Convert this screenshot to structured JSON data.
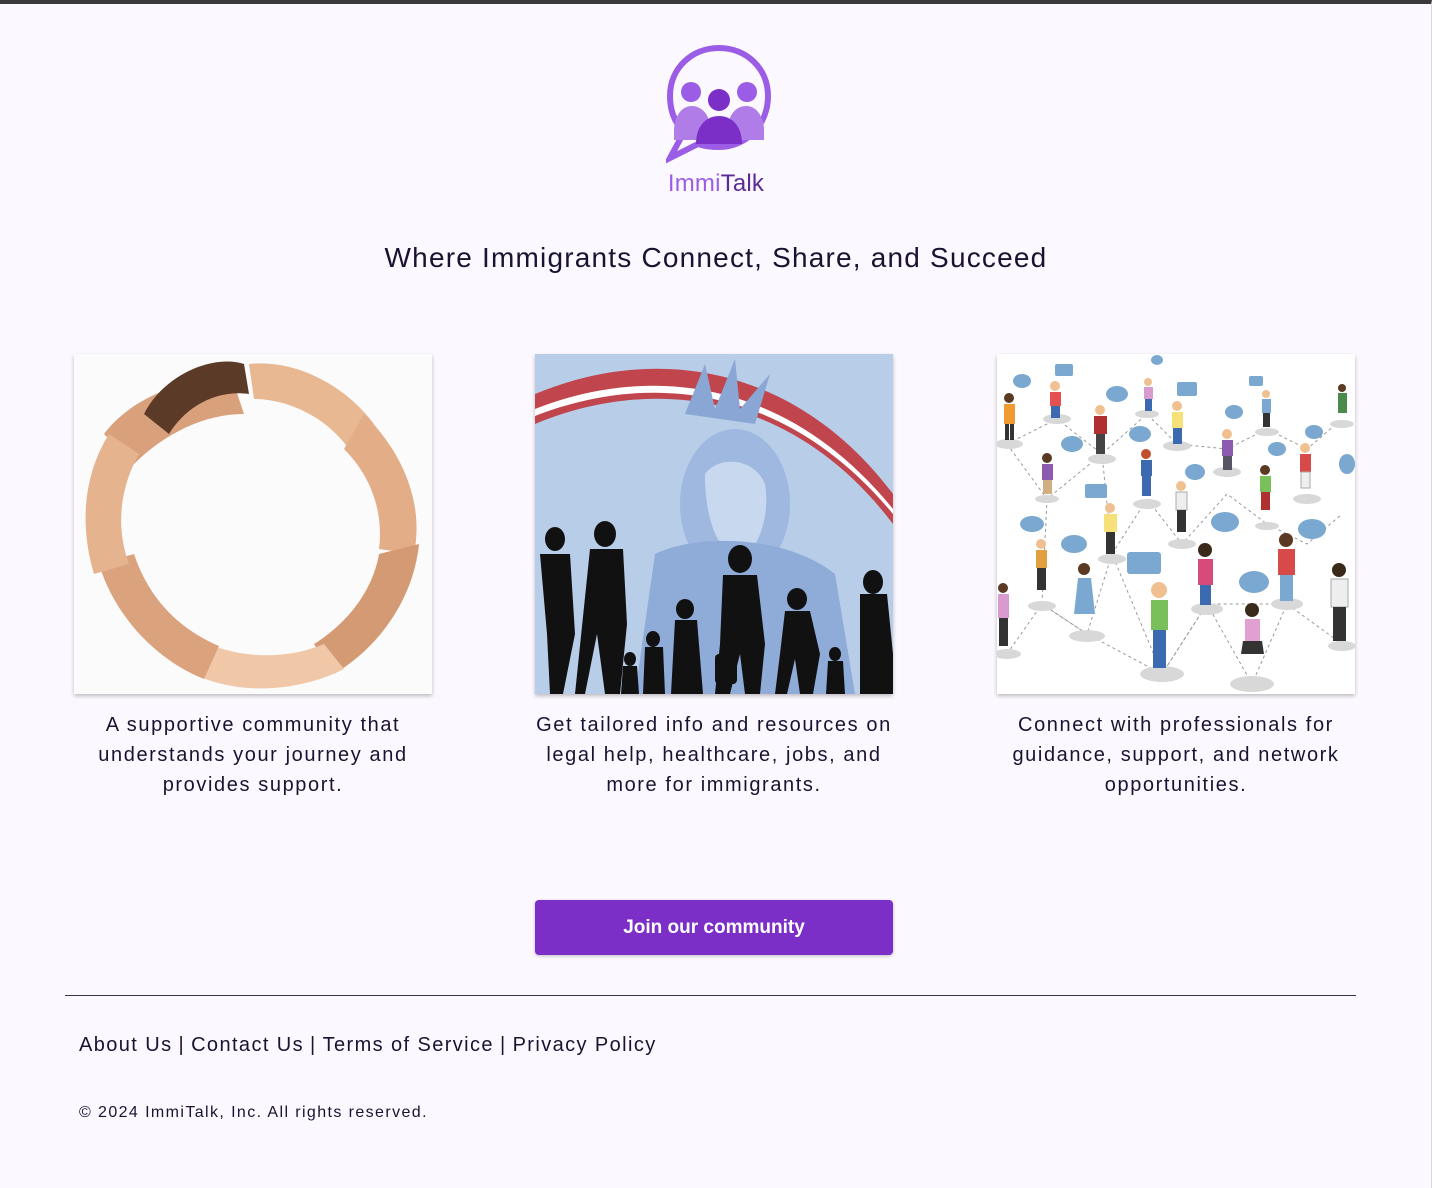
{
  "brand": {
    "name_part1": "Immi",
    "name_part2": "Talk",
    "color_light": "#9b5de5",
    "color_dark": "#5a2a9a"
  },
  "hero": {
    "tagline": "Where Immigrants Connect, Share, and Succeed"
  },
  "features": [
    {
      "image": "hands-circle-image",
      "text": "A supportive community that understands your journey and provides support."
    },
    {
      "image": "statue-of-liberty-immigrants-image",
      "text": "Get tailored info and resources on legal help, healthcare, jobs, and more for immigrants."
    },
    {
      "image": "people-network-image",
      "text": "Connect with professionals for guidance, support, and network opportunities."
    }
  ],
  "cta": {
    "label": "Join our community",
    "color": "#7b2fc7"
  },
  "footer": {
    "links": [
      "About Us",
      "Contact Us",
      "Terms of Service",
      "Privacy Policy"
    ],
    "separator": "|",
    "copyright": "© 2024 ImmiTalk, Inc. All rights reserved."
  }
}
